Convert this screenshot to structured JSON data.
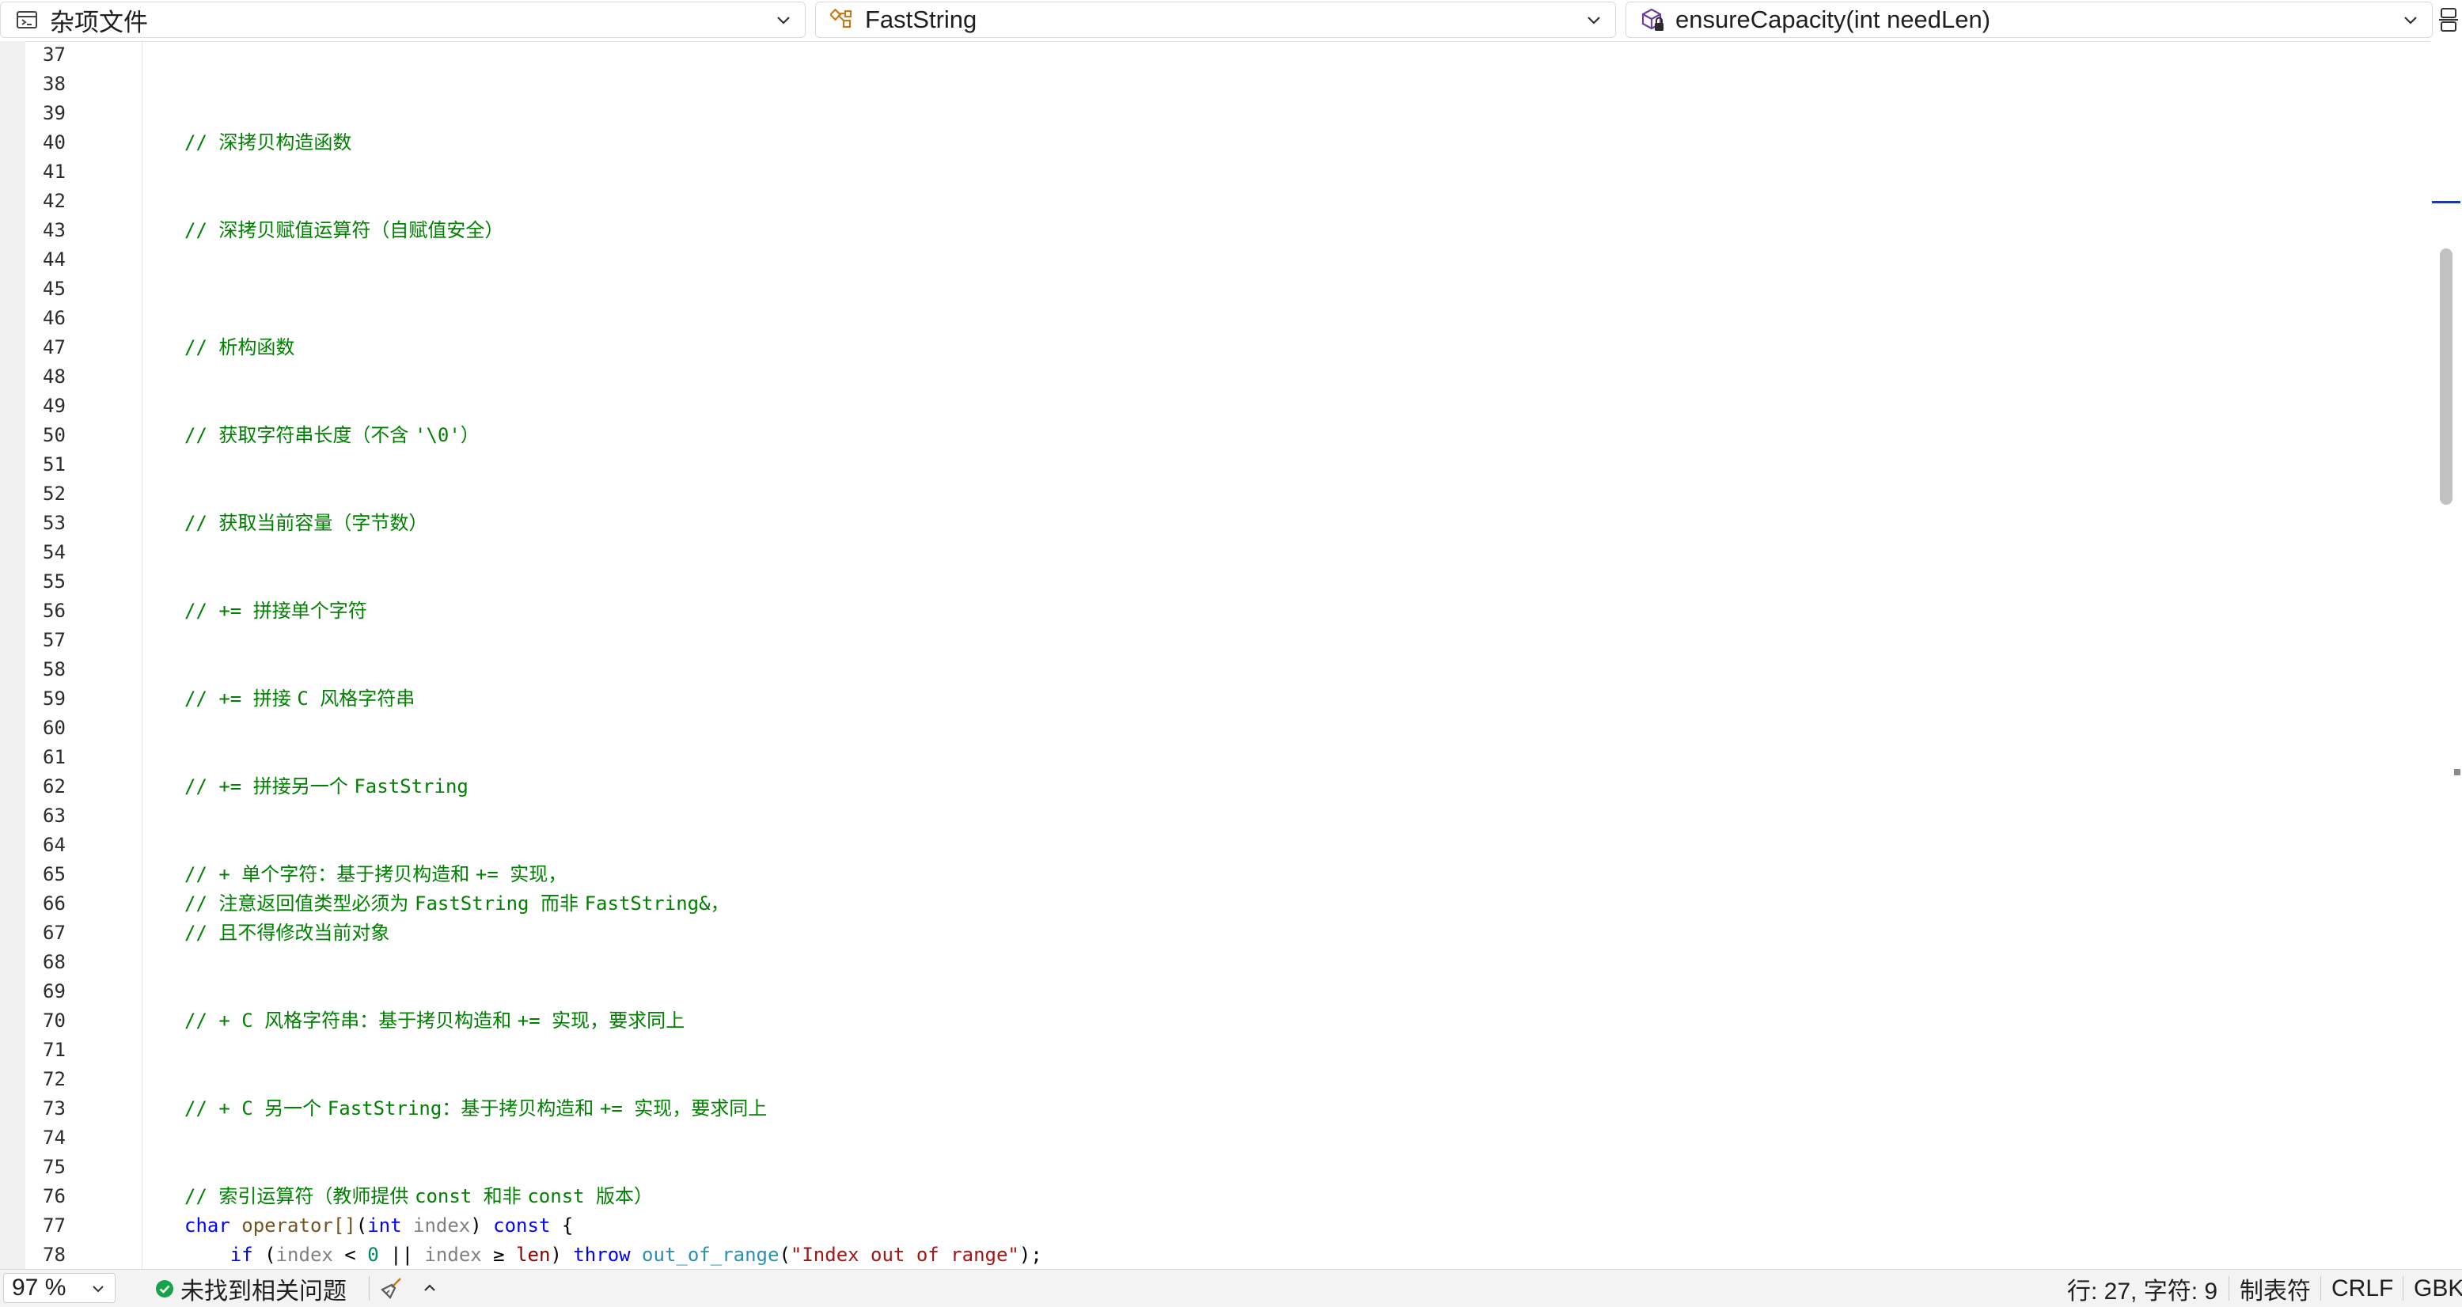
{
  "navbar": {
    "file_scope": "杂项文件",
    "type_scope": "FastString",
    "member_scope": "ensureCapacity(int needLen)"
  },
  "editor": {
    "lines": [
      {
        "num": "37",
        "tokens": []
      },
      {
        "num": "38",
        "tokens": []
      },
      {
        "num": "39",
        "tokens": []
      },
      {
        "num": "40",
        "tokens": [
          {
            "cls": "tok-comment",
            "text": "// "
          },
          {
            "cls": "tok-comment tok-comment-cjk",
            "text": "深拷贝构造函数"
          }
        ]
      },
      {
        "num": "41",
        "tokens": []
      },
      {
        "num": "42",
        "tokens": []
      },
      {
        "num": "43",
        "tokens": [
          {
            "cls": "tok-comment",
            "text": "// "
          },
          {
            "cls": "tok-comment tok-comment-cjk",
            "text": "深拷贝赋值运算符（自赋值安全）"
          }
        ]
      },
      {
        "num": "44",
        "tokens": []
      },
      {
        "num": "45",
        "tokens": []
      },
      {
        "num": "46",
        "tokens": []
      },
      {
        "num": "47",
        "tokens": [
          {
            "cls": "tok-comment",
            "text": "// "
          },
          {
            "cls": "tok-comment tok-comment-cjk",
            "text": "析构函数"
          }
        ]
      },
      {
        "num": "48",
        "tokens": []
      },
      {
        "num": "49",
        "tokens": []
      },
      {
        "num": "50",
        "tokens": [
          {
            "cls": "tok-comment",
            "text": "// "
          },
          {
            "cls": "tok-comment tok-comment-cjk",
            "text": "获取字符串长度（不含 "
          },
          {
            "cls": "tok-comment",
            "text": "'\\0'"
          },
          {
            "cls": "tok-comment tok-comment-cjk",
            "text": "）"
          }
        ]
      },
      {
        "num": "51",
        "tokens": []
      },
      {
        "num": "52",
        "tokens": []
      },
      {
        "num": "53",
        "tokens": [
          {
            "cls": "tok-comment",
            "text": "// "
          },
          {
            "cls": "tok-comment tok-comment-cjk",
            "text": "获取当前容量（字节数）"
          }
        ]
      },
      {
        "num": "54",
        "tokens": []
      },
      {
        "num": "55",
        "tokens": []
      },
      {
        "num": "56",
        "tokens": [
          {
            "cls": "tok-comment",
            "text": "// += "
          },
          {
            "cls": "tok-comment tok-comment-cjk",
            "text": "拼接单个字符"
          }
        ]
      },
      {
        "num": "57",
        "tokens": []
      },
      {
        "num": "58",
        "tokens": []
      },
      {
        "num": "59",
        "tokens": [
          {
            "cls": "tok-comment",
            "text": "// += "
          },
          {
            "cls": "tok-comment tok-comment-cjk",
            "text": "拼接 "
          },
          {
            "cls": "tok-comment",
            "text": "C "
          },
          {
            "cls": "tok-comment tok-comment-cjk",
            "text": "风格字符串"
          }
        ]
      },
      {
        "num": "60",
        "tokens": []
      },
      {
        "num": "61",
        "tokens": []
      },
      {
        "num": "62",
        "tokens": [
          {
            "cls": "tok-comment",
            "text": "// += "
          },
          {
            "cls": "tok-comment tok-comment-cjk",
            "text": "拼接另一个 "
          },
          {
            "cls": "tok-comment",
            "text": "FastString"
          }
        ]
      },
      {
        "num": "63",
        "tokens": []
      },
      {
        "num": "64",
        "tokens": []
      },
      {
        "num": "65",
        "tokens": [
          {
            "cls": "tok-comment",
            "text": "// + "
          },
          {
            "cls": "tok-comment tok-comment-cjk",
            "text": "单个字符：基于拷贝构造和 "
          },
          {
            "cls": "tok-comment",
            "text": "+= "
          },
          {
            "cls": "tok-comment tok-comment-cjk",
            "text": "实现，"
          }
        ]
      },
      {
        "num": "66",
        "tokens": [
          {
            "cls": "tok-comment",
            "text": "// "
          },
          {
            "cls": "tok-comment tok-comment-cjk",
            "text": "注意返回值类型必须为 "
          },
          {
            "cls": "tok-comment",
            "text": "FastString "
          },
          {
            "cls": "tok-comment tok-comment-cjk",
            "text": "而非 "
          },
          {
            "cls": "tok-comment",
            "text": "FastString&"
          },
          {
            "cls": "tok-comment tok-comment-cjk",
            "text": "，"
          }
        ]
      },
      {
        "num": "67",
        "tokens": [
          {
            "cls": "tok-comment",
            "text": "// "
          },
          {
            "cls": "tok-comment tok-comment-cjk",
            "text": "且不得修改当前对象"
          }
        ]
      },
      {
        "num": "68",
        "tokens": []
      },
      {
        "num": "69",
        "tokens": []
      },
      {
        "num": "70",
        "tokens": [
          {
            "cls": "tok-comment",
            "text": "// + C "
          },
          {
            "cls": "tok-comment tok-comment-cjk",
            "text": "风格字符串：基于拷贝构造和 "
          },
          {
            "cls": "tok-comment",
            "text": "+= "
          },
          {
            "cls": "tok-comment tok-comment-cjk",
            "text": "实现，要求同上"
          }
        ]
      },
      {
        "num": "71",
        "tokens": []
      },
      {
        "num": "72",
        "tokens": []
      },
      {
        "num": "73",
        "tokens": [
          {
            "cls": "tok-comment",
            "text": "// + C "
          },
          {
            "cls": "tok-comment tok-comment-cjk",
            "text": "另一个 "
          },
          {
            "cls": "tok-comment",
            "text": "FastString"
          },
          {
            "cls": "tok-comment tok-comment-cjk",
            "text": "：基于拷贝构造和 "
          },
          {
            "cls": "tok-comment",
            "text": "+= "
          },
          {
            "cls": "tok-comment tok-comment-cjk",
            "text": "实现，要求同上"
          }
        ]
      },
      {
        "num": "74",
        "tokens": []
      },
      {
        "num": "75",
        "tokens": []
      },
      {
        "num": "76",
        "tokens": [
          {
            "cls": "tok-comment",
            "text": "// "
          },
          {
            "cls": "tok-comment tok-comment-cjk",
            "text": "索引运算符（教师提供 "
          },
          {
            "cls": "tok-comment",
            "text": "const "
          },
          {
            "cls": "tok-comment tok-comment-cjk",
            "text": "和非 "
          },
          {
            "cls": "tok-comment",
            "text": "const "
          },
          {
            "cls": "tok-comment tok-comment-cjk",
            "text": "版本）"
          }
        ]
      },
      {
        "num": "77",
        "tokens": [
          {
            "cls": "tok-keyword",
            "text": "char "
          },
          {
            "cls": "tok-func",
            "text": "operator[]"
          },
          {
            "cls": "tok-punct",
            "text": "("
          },
          {
            "cls": "tok-keyword",
            "text": "int "
          },
          {
            "cls": "tok-param",
            "text": "index"
          },
          {
            "cls": "tok-punct",
            "text": ") "
          },
          {
            "cls": "tok-keyword",
            "text": "const "
          },
          {
            "cls": "tok-punct",
            "text": "{"
          }
        ]
      },
      {
        "num": "78",
        "tokens": [
          {
            "cls": "tok-punct",
            "text": "    "
          },
          {
            "cls": "tok-keyword",
            "text": "if "
          },
          {
            "cls": "tok-punct",
            "text": "("
          },
          {
            "cls": "tok-param",
            "text": "index"
          },
          {
            "cls": "tok-punct",
            "text": " < "
          },
          {
            "cls": "tok-number",
            "text": "0"
          },
          {
            "cls": "tok-punct",
            "text": " || "
          },
          {
            "cls": "tok-param",
            "text": "index"
          },
          {
            "cls": "tok-punct",
            "text": " ≥ "
          },
          {
            "cls": "tok-member",
            "text": "len"
          },
          {
            "cls": "tok-punct",
            "text": ") "
          },
          {
            "cls": "tok-keyword",
            "text": "throw "
          },
          {
            "cls": "tok-class",
            "text": "out_of_range"
          },
          {
            "cls": "tok-punct",
            "text": "("
          },
          {
            "cls": "tok-string",
            "text": "\"Index out of range\""
          },
          {
            "cls": "tok-punct",
            "text": ");"
          }
        ]
      }
    ]
  },
  "statusbar": {
    "zoom": "97 %",
    "issues": "未找到相关问题",
    "cursor_position": "行: 27, 字符: 9",
    "indent_mode": "制表符",
    "line_endings": "CRLF",
    "encoding": "GBK"
  },
  "icons": {
    "file_scope": "misc-files-icon",
    "type_scope": "class-icon",
    "member_scope": "method-icon",
    "issues_ok": "check-circle-icon",
    "cleanup": "broom-icon"
  },
  "colors": {
    "comment": "#008000",
    "keyword": "#0000ff",
    "string": "#a31515",
    "class": "#2b91af",
    "ok_green": "#16a34a",
    "scroll_caret": "#1e3a9e"
  }
}
